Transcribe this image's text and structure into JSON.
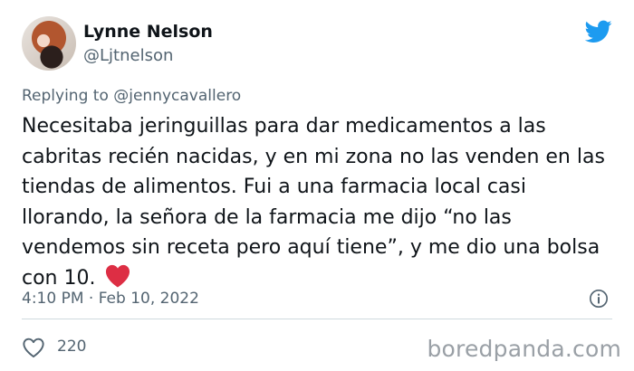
{
  "author": {
    "name": "Lynne Nelson",
    "handle": "@Ljtnelson",
    "avatar_icon": "profile-photo"
  },
  "brand_icon": "twitter-bird-icon",
  "brand_color": "#1d9bf0",
  "reply": {
    "prefix": "Replying to",
    "mention": "@jennycavallero"
  },
  "tweet": {
    "text": "Necesitaba jeringuillas para dar medicamentos a las cabritas recién nacidas, y en mi zona no las venden en las tiendas de alimentos. Fui a una farmacia local casi llorando, la señora de la farmacia me dijo “no las vendemos sin receta pero aquí tiene”, y me dio una bolsa con 10.",
    "emoji": "red-heart",
    "timestamp": "4:10 PM · Feb 10, 2022"
  },
  "stats": {
    "likes": "220"
  },
  "watermark": "boredpanda.com"
}
